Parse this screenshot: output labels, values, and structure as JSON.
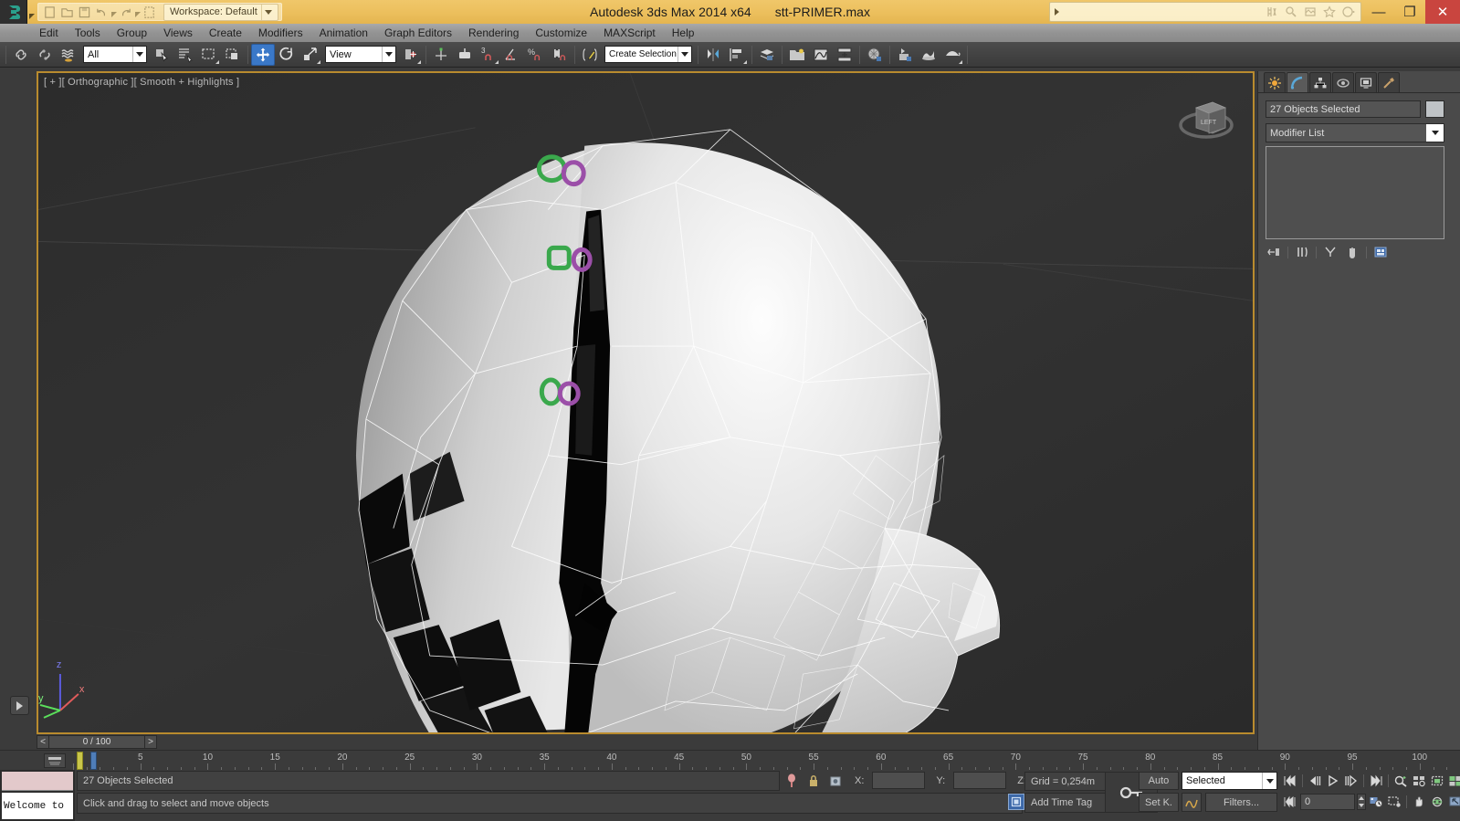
{
  "titlebar": {
    "workspace_label": "Workspace: Default",
    "app_title": "Autodesk 3ds Max  2014 x64",
    "file_name": "stt-PRIMER.max",
    "search_placeholder": "",
    "search_value": "",
    "minimize_glyph": "—",
    "restore_glyph": "❐",
    "close_glyph": "✕",
    "quick_icons": [
      "new-icon",
      "open-icon",
      "save-icon",
      "undo-icon",
      "redo-icon",
      "file-icon"
    ],
    "search_icons": [
      "render-setup-icon",
      "render-frame-icon",
      "render-production-icon",
      "favorites-icon",
      "help-circle-icon"
    ]
  },
  "menubar": {
    "items": [
      {
        "label": "Edit",
        "name": "menu-edit"
      },
      {
        "label": "Tools",
        "name": "menu-tools"
      },
      {
        "label": "Group",
        "name": "menu-group"
      },
      {
        "label": "Views",
        "name": "menu-views"
      },
      {
        "label": "Create",
        "name": "menu-create"
      },
      {
        "label": "Modifiers",
        "name": "menu-modifiers"
      },
      {
        "label": "Animation",
        "name": "menu-animation"
      },
      {
        "label": "Graph Editors",
        "name": "menu-graph-editors"
      },
      {
        "label": "Rendering",
        "name": "menu-rendering"
      },
      {
        "label": "Customize",
        "name": "menu-customize"
      },
      {
        "label": "MAXScript",
        "name": "menu-maxscript"
      },
      {
        "label": "Help",
        "name": "menu-help"
      }
    ]
  },
  "toolbar": {
    "selection_filter": "All",
    "reference_coord": "View",
    "named_selection_set": "Create Selection Se",
    "active_tool": "select-and-move"
  },
  "viewport": {
    "label": "[ + ][ Orthographic ][ Smooth + Highlights ]",
    "viewcube_face": "LEFT",
    "axis_labels": [
      "z",
      "x",
      "y"
    ]
  },
  "command_panel": {
    "tabs": [
      "create-tab",
      "modify-tab",
      "hierarchy-tab",
      "motion-tab",
      "display-tab",
      "utilities-tab"
    ],
    "active_tab_index": 1,
    "object_name": "27 Objects Selected",
    "modifier_list_label": "Modifier List",
    "stack_buttons": [
      "pin-stack-icon",
      "show-end-result-icon",
      "make-unique-icon",
      "remove-modifier-icon",
      "configure-sets-icon"
    ]
  },
  "timeline": {
    "slider_label": "0 / 100",
    "prev_glyph": "<",
    "next_glyph": ">",
    "ruler_labels": [
      "5",
      "10",
      "15",
      "20",
      "25",
      "30",
      "35",
      "40",
      "45",
      "50",
      "55",
      "60",
      "65",
      "70",
      "75",
      "80",
      "85",
      "90",
      "95",
      "100"
    ],
    "ruler_values": [
      5,
      10,
      15,
      20,
      25,
      30,
      35,
      40,
      45,
      50,
      55,
      60,
      65,
      70,
      75,
      80,
      85,
      90,
      95,
      100
    ]
  },
  "statusbar": {
    "mini_listener_text": "Welcome to",
    "selection_status": "27 Objects Selected",
    "prompt": "Click and drag to select and move objects",
    "coord_x_label": "X:",
    "coord_y_label": "Y:",
    "coord_z_label": "Z:",
    "coord_x_value": "",
    "coord_y_value": "",
    "coord_z_value": "",
    "grid_text": "Grid = 0,254m",
    "add_time_tag": "Add Time Tag",
    "auto_key": "Auto",
    "set_key": "Set K.",
    "key_filter_set": "Selected",
    "filters_button": "Filters...",
    "current_frame": "0",
    "icons": [
      "pin-stack-icon",
      "lock-selection-icon",
      "absolute-mode-icon"
    ],
    "playback_icons": [
      "goto-start-icon",
      "prev-frame-icon",
      "play-icon",
      "next-frame-icon",
      "goto-end-icon",
      "zoom-extents-icon",
      "zoom-region-icon",
      "zoom-all-icon",
      "field-of-view-icon"
    ],
    "nav_icons2": [
      "key-mode-icon",
      "time-config-icon",
      "zoom-extents-sel-icon",
      "pan-view-icon",
      "orbit-icon",
      "maximize-viewport-icon"
    ]
  },
  "colors": {
    "title_gold": "#ecbf5c",
    "close_red": "#c9453f",
    "viewport_border": "#b98b2e",
    "accent_blue": "#3a78c8",
    "marker_green": "#3aa84c",
    "marker_purple": "#9b4fa8",
    "panel_gray": "#4a4a4a"
  }
}
